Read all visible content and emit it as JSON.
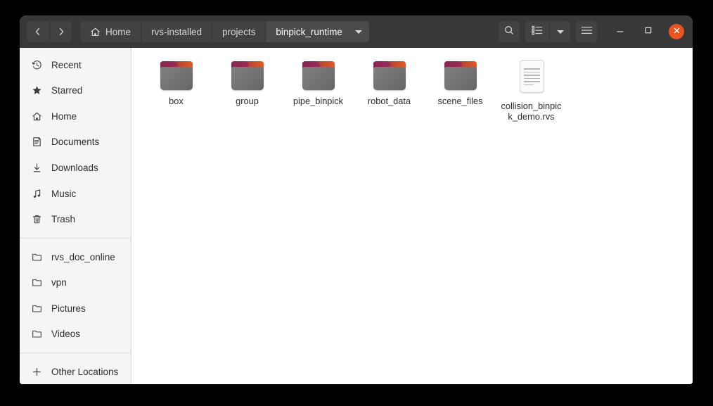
{
  "window": {
    "nav": {
      "back_label": "Back",
      "forward_label": "Forward"
    },
    "breadcrumbs": [
      {
        "label": "Home",
        "icon": "home-icon",
        "current": false
      },
      {
        "label": "rvs-installed",
        "icon": "",
        "current": false
      },
      {
        "label": "projects",
        "icon": "",
        "current": false
      },
      {
        "label": "binpick_runtime",
        "icon": "chevron-down-icon",
        "current": true
      }
    ],
    "toolbar": {
      "search_label": "Search",
      "view_label": "List view",
      "view_options_label": "View options",
      "menu_label": "Main menu"
    },
    "controls": {
      "minimize_label": "Minimize",
      "maximize_label": "Maximize",
      "close_label": "Close",
      "close_color": "#e95420"
    }
  },
  "sidebar": {
    "places": [
      {
        "label": "Recent",
        "icon": "clock-icon"
      },
      {
        "label": "Starred",
        "icon": "star-icon"
      },
      {
        "label": "Home",
        "icon": "home-icon"
      },
      {
        "label": "Documents",
        "icon": "documents-icon"
      },
      {
        "label": "Downloads",
        "icon": "download-icon"
      },
      {
        "label": "Music",
        "icon": "music-note-icon"
      },
      {
        "label": "Trash",
        "icon": "trash-icon"
      }
    ],
    "bookmarks": [
      {
        "label": "rvs_doc_online",
        "icon": "folder-icon"
      },
      {
        "label": "vpn",
        "icon": "folder-icon"
      },
      {
        "label": "Pictures",
        "icon": "folder-icon"
      },
      {
        "label": "Videos",
        "icon": "folder-icon"
      }
    ],
    "other": {
      "label": "Other Locations",
      "icon": "plus-icon"
    }
  },
  "files": [
    {
      "name": "box",
      "type": "folder"
    },
    {
      "name": "group",
      "type": "folder"
    },
    {
      "name": "pipe_binpick",
      "type": "folder"
    },
    {
      "name": "robot_data",
      "type": "folder"
    },
    {
      "name": "scene_files",
      "type": "folder"
    },
    {
      "name": "collision_binpick_demo.rvs",
      "type": "document"
    }
  ]
}
